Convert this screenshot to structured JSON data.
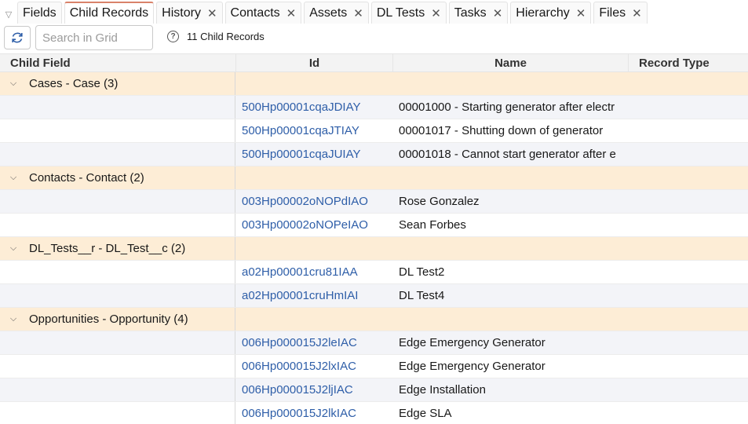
{
  "tabs": [
    {
      "label": "Fields",
      "closable": false,
      "active": false
    },
    {
      "label": "Child Records",
      "closable": false,
      "active": true
    },
    {
      "label": "History",
      "closable": true,
      "active": false
    },
    {
      "label": "Contacts",
      "closable": true,
      "active": false
    },
    {
      "label": "Assets",
      "closable": true,
      "active": false
    },
    {
      "label": "DL Tests",
      "closable": true,
      "active": false
    },
    {
      "label": "Tasks",
      "closable": true,
      "active": false
    },
    {
      "label": "Hierarchy",
      "closable": true,
      "active": false
    },
    {
      "label": "Files",
      "closable": true,
      "active": false
    }
  ],
  "toolbar": {
    "search_placeholder": "Search in Grid",
    "record_count": "11 Child Records"
  },
  "grid": {
    "columns": [
      "Child Field",
      "Id",
      "Name",
      "Record Type"
    ],
    "groups": [
      {
        "label": "Cases - Case (3)",
        "rows": [
          {
            "id": "500Hp00001cqaJDIAY",
            "name": "00001000 - Starting generator after electr",
            "type": ""
          },
          {
            "id": "500Hp00001cqaJTIAY",
            "name": "00001017 - Shutting down of generator",
            "type": ""
          },
          {
            "id": "500Hp00001cqaJUIAY",
            "name": "00001018 - Cannot start generator after e",
            "type": ""
          }
        ]
      },
      {
        "label": "Contacts - Contact (2)",
        "rows": [
          {
            "id": "003Hp00002oNOPdIAO",
            "name": "Rose Gonzalez",
            "type": ""
          },
          {
            "id": "003Hp00002oNOPeIAO",
            "name": "Sean Forbes",
            "type": ""
          }
        ]
      },
      {
        "label": "DL_Tests__r - DL_Test__c (2)",
        "rows": [
          {
            "id": "a02Hp00001cru81IAA",
            "name": "DL Test2",
            "type": ""
          },
          {
            "id": "a02Hp00001cruHmIAI",
            "name": "DL Test4",
            "type": ""
          }
        ]
      },
      {
        "label": "Opportunities - Opportunity (4)",
        "rows": [
          {
            "id": "006Hp000015J2leIAC",
            "name": "Edge Emergency Generator",
            "type": ""
          },
          {
            "id": "006Hp000015J2lxIAC",
            "name": "Edge Emergency Generator",
            "type": ""
          },
          {
            "id": "006Hp000015J2ljIAC",
            "name": "Edge Installation",
            "type": ""
          },
          {
            "id": "006Hp000015J2lkIAC",
            "name": "Edge SLA",
            "type": ""
          }
        ]
      }
    ]
  },
  "colors": {
    "accent": "#d9826a",
    "link": "#2e5ea8",
    "group_bg": "#fdedd6",
    "alt_row_bg": "#f3f4f8",
    "header_bg": "#f3f3f3"
  },
  "icons": {
    "tab_menu": "triangle-down-icon",
    "refresh": "refresh-icon",
    "info": "help-circle-icon",
    "group_toggle": "chevron-down-icon",
    "tab_close": "close-icon"
  }
}
